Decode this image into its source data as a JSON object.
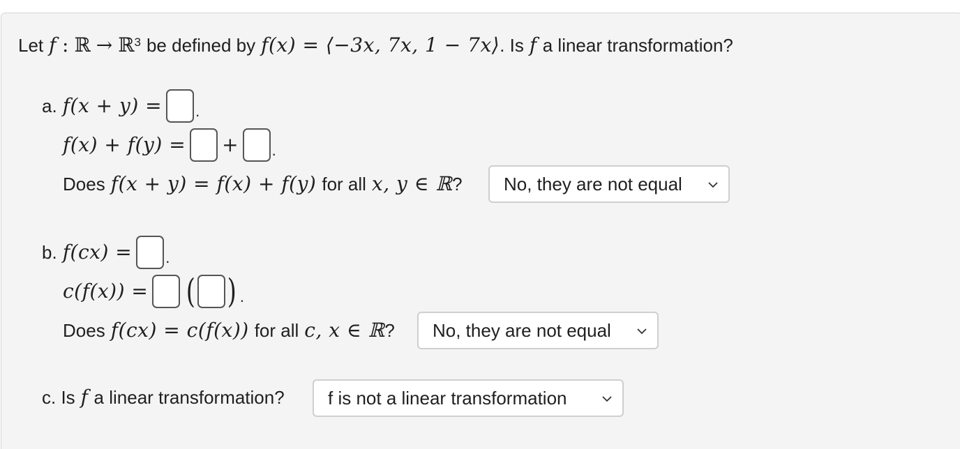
{
  "question": {
    "let": "Let",
    "f": "f",
    "colon": ":",
    "R": "ℝ",
    "arrow": "→",
    "R3_base": "ℝ",
    "R3_exp": "3",
    "be_defined_by": "be defined by",
    "fx_def": "f(x) = ⟨−3x, 7x, 1 − 7x⟩",
    "is_f": ". Is",
    "f2": "f",
    "a_linear": "a linear transformation?"
  },
  "part_a": {
    "label": "a.",
    "lhs1": "f(x + y) =",
    "lhs2": "f(x) + f(y) =",
    "plus": "+",
    "does": "Does",
    "equation": "f(x + y) = f(x) + f(y)",
    "for_all": "for all",
    "vars": "x, y ∈ ℝ",
    "qmark": "?",
    "select_value": "No, they are not equal"
  },
  "part_b": {
    "label": "b.",
    "lhs1": "f(cx) =",
    "lhs2": "c(f(x)) =",
    "lparen": "(",
    "rparen": ")",
    "does": "Does",
    "equation": "f(cx) = c(f(x))",
    "for_all": "for all",
    "vars": "c, x ∈ ℝ",
    "qmark": "?",
    "select_value": "No, they are not equal"
  },
  "part_c": {
    "label": "c. Is",
    "f": "f",
    "text": "a linear transformation?",
    "select_value": "f is not a linear transformation"
  },
  "icons": {
    "dropdown": "chevron-down-icon"
  }
}
